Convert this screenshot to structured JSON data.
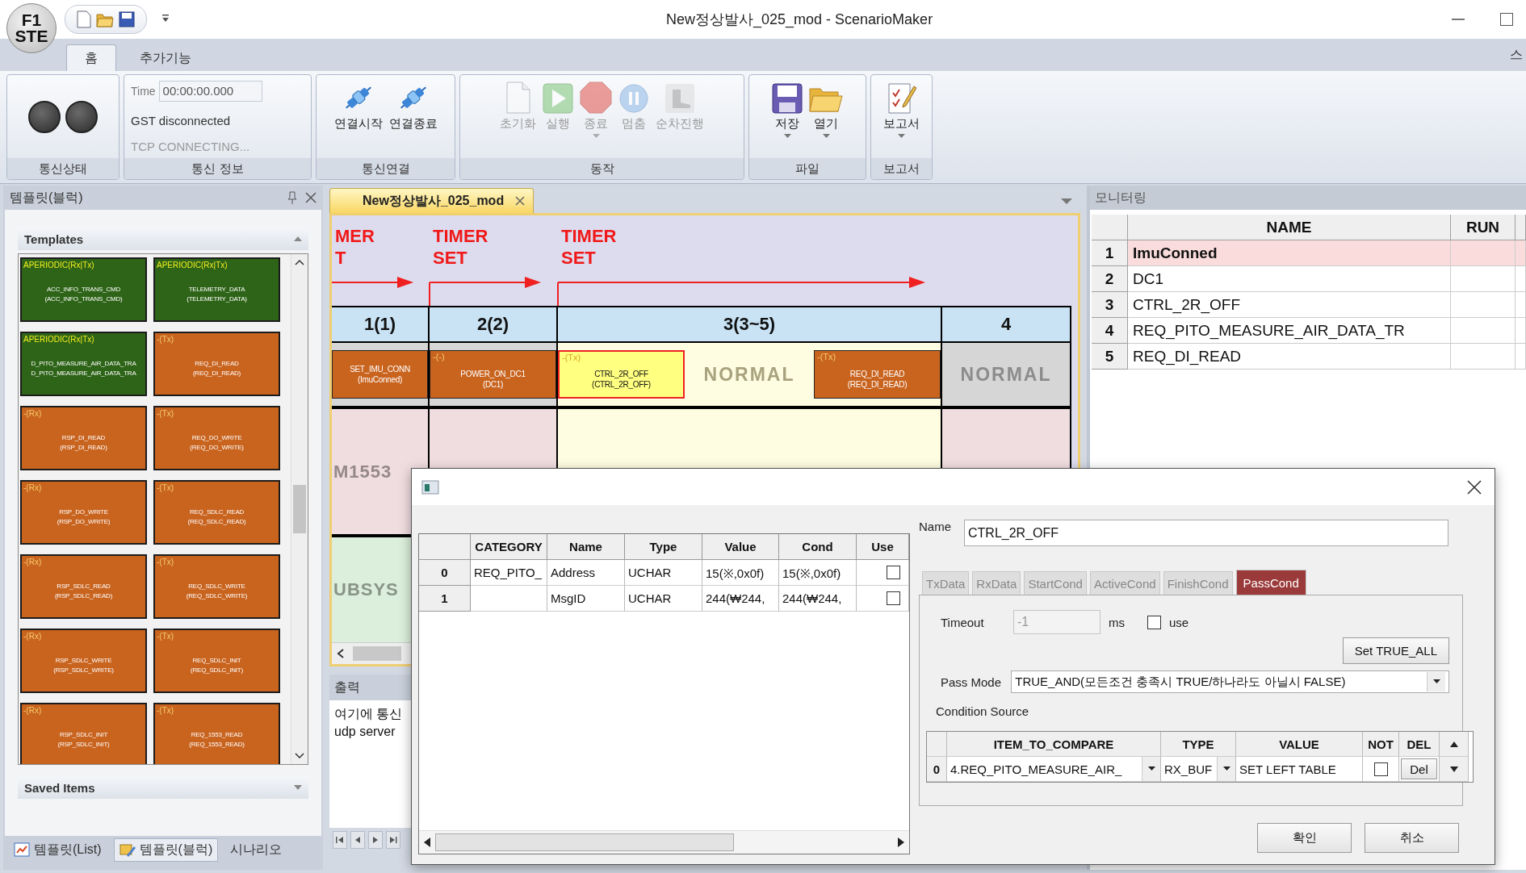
{
  "window": {
    "title": "New정상발사_025_mod - ScenarioMaker",
    "logo_lines": [
      "F1",
      "STE"
    ]
  },
  "ribbon": {
    "tabs": [
      {
        "label": "홈",
        "selected": true
      },
      {
        "label": "추가기능",
        "selected": false
      }
    ],
    "right_tab": "스",
    "groups": [
      {
        "label": "통신상태",
        "kind": "lamps",
        "lamps": [
          {
            "on": false
          },
          {
            "on": false
          }
        ]
      },
      {
        "label": "통신 정보",
        "kind": "info",
        "time_label": "Time",
        "time_value": "00:00:00.000",
        "lines": [
          {
            "text": "GST disconnected",
            "disabled": false
          },
          {
            "text": "TCP CONNECTING...",
            "disabled": true
          }
        ]
      },
      {
        "label": "통신연결",
        "kind": "buttons",
        "buttons": [
          {
            "label": "연결시작",
            "disabled": false,
            "menu": false
          },
          {
            "label": "연결종료",
            "disabled": false,
            "menu": false
          }
        ]
      },
      {
        "label": "동작",
        "kind": "buttons",
        "buttons": [
          {
            "label": "초기화",
            "disabled": true,
            "menu": false
          },
          {
            "label": "실행",
            "disabled": true,
            "menu": false
          },
          {
            "label": "종료",
            "disabled": true,
            "menu": true
          },
          {
            "label": "멈춤",
            "disabled": true,
            "menu": false
          },
          {
            "label": "순차진행",
            "disabled": true,
            "menu": false
          }
        ]
      },
      {
        "label": "파일",
        "kind": "buttons",
        "buttons": [
          {
            "label": "저장",
            "disabled": false,
            "menu": true
          },
          {
            "label": "열기",
            "disabled": false,
            "menu": true
          }
        ]
      },
      {
        "label": "보고서",
        "kind": "buttons",
        "buttons": [
          {
            "label": "보고서",
            "disabled": false,
            "menu": true
          }
        ]
      }
    ]
  },
  "templates": {
    "title": "템플릿(블럭)",
    "templates_label": "Templates",
    "saved_label": "Saved Items",
    "items": [
      {
        "kind": "aperiodic",
        "tag": "APERIODIC(Rx|Tx)",
        "lines": [
          "ACC_INFO_TRANS_CMD",
          "(ACC_INFO_TRANS_CMD)"
        ]
      },
      {
        "kind": "aperiodic",
        "tag": "APERIODIC(Rx|Tx)",
        "lines": [
          "TELEMETRY_DATA",
          "(TELEMETRY_DATA)"
        ]
      },
      {
        "kind": "aperiodic",
        "tag": "APERIODIC(Rx|Tx)",
        "lines": [
          "D_PITO_MEASURE_AIR_DATA_TRA",
          "D_PITO_MEASURE_AIR_DATA_TRA"
        ]
      },
      {
        "kind": "normal",
        "tag": "-(Tx)",
        "lines": [
          "REQ_DI_READ",
          "(REQ_DI_READ)"
        ]
      },
      {
        "kind": "normal",
        "tag": "-(Rx)",
        "lines": [
          "RSP_DI_READ",
          "(RSP_DI_READ)"
        ]
      },
      {
        "kind": "normal",
        "tag": "-(Tx)",
        "lines": [
          "REQ_DO_WRITE",
          "(REQ_DO_WRITE)"
        ]
      },
      {
        "kind": "normal",
        "tag": "-(Rx)",
        "lines": [
          "RSP_DO_WRITE",
          "(RSP_DO_WRITE)"
        ]
      },
      {
        "kind": "normal",
        "tag": "-(Tx)",
        "lines": [
          "REQ_SDLC_READ",
          "(REQ_SDLC_READ)"
        ]
      },
      {
        "kind": "normal",
        "tag": "-(Rx)",
        "lines": [
          "RSP_SDLC_READ",
          "(RSP_SDLC_READ)"
        ]
      },
      {
        "kind": "normal",
        "tag": "-(Tx)",
        "lines": [
          "REQ_SDLC_WRITE",
          "(REQ_SDLC_WRITE)"
        ]
      },
      {
        "kind": "normal",
        "tag": "-(Rx)",
        "lines": [
          "RSP_SDLC_WRITE",
          "(RSP_SDLC_WRITE)"
        ]
      },
      {
        "kind": "normal",
        "tag": "-(Tx)",
        "lines": [
          "REQ_SDLC_INIT",
          "(REQ_SDLC_INIT)"
        ]
      },
      {
        "kind": "normal",
        "tag": "-(Rx)",
        "lines": [
          "RSP_SDLC_INIT",
          "(RSP_SDLC_INIT)"
        ]
      },
      {
        "kind": "normal",
        "tag": "-(Tx)",
        "lines": [
          "REQ_1553_READ",
          "(REQ_1553_READ)"
        ]
      }
    ],
    "bottom_tabs": [
      {
        "label": "템플릿(List)",
        "selected": false
      },
      {
        "label": "템플릿(블럭)",
        "selected": true
      },
      {
        "label": "시나리오",
        "selected": false
      }
    ]
  },
  "editor": {
    "tab": {
      "label": "New정상발사_025_mod",
      "selected": true
    },
    "columns": [
      {
        "header": "1(1)",
        "active": false,
        "timer": {
          "lines": [
            "MER",
            "T"
          ],
          "partial": true
        },
        "blocks": [
          {
            "kind": "block",
            "lines": [
              "SET_IMU_CONN",
              "(ImuConned)"
            ],
            "selected": false
          }
        ]
      },
      {
        "header": "2(2)",
        "active": false,
        "timer": {
          "lines": [
            "TIMER",
            "SET"
          ],
          "partial": false
        },
        "blocks": [
          {
            "kind": "block",
            "tag": "-(-)",
            "lines": [
              "POWER_ON_DC1",
              "(DC1)"
            ],
            "selected": false
          }
        ]
      },
      {
        "header": "3(3~5)",
        "active": true,
        "timer": {
          "lines": [
            "TIMER",
            "SET"
          ],
          "partial": false
        },
        "blocks": [
          {
            "kind": "block",
            "tag": "-(Tx)",
            "lines": [
              "CTRL_2R_OFF",
              "(CTRL_2R_OFF)"
            ],
            "selected": true
          },
          {
            "kind": "state",
            "label": "NORMAL"
          },
          {
            "kind": "block",
            "tag": "-(Tx)",
            "lines": [
              "REQ_DI_READ",
              "(REQ_DI_READ)"
            ],
            "selected": false
          }
        ]
      },
      {
        "header": "4",
        "active": false,
        "blocks": [
          {
            "kind": "state",
            "label": "NORMAL"
          }
        ]
      }
    ],
    "lanes": [
      {
        "label": "M1553",
        "color": "#f0dde0"
      },
      {
        "label": "UBSYS",
        "color": "#dcefdc"
      }
    ],
    "output": {
      "title": "출력",
      "lines": [
        "여기에 통신",
        "udp server"
      ]
    }
  },
  "monitor": {
    "title": "모니터링",
    "columns": [
      "NAME",
      "RUN"
    ],
    "rows": [
      {
        "index": "1",
        "name": "ImuConned",
        "selected": true
      },
      {
        "index": "2",
        "name": "DC1",
        "selected": false
      },
      {
        "index": "3",
        "name": "CTRL_2R_OFF",
        "selected": false
      },
      {
        "index": "4",
        "name": "REQ_PITO_MEASURE_AIR_DATA_TR",
        "selected": false
      },
      {
        "index": "5",
        "name": "REQ_DI_READ",
        "selected": false
      }
    ]
  },
  "dialog": {
    "table": {
      "columns": [
        "CATEGORY",
        "Name",
        "Type",
        "Value",
        "Cond",
        "Use"
      ],
      "rows": [
        {
          "index": "0",
          "category": "REQ_PITO_",
          "name": "Address",
          "type": "UCHAR",
          "value": "15(※,0x0f)",
          "cond": "15(※,0x0f)",
          "use": false
        },
        {
          "index": "1",
          "name": "MsgID",
          "type": "UCHAR",
          "value": "244(₩244,",
          "cond": "244(₩244,",
          "use": false
        }
      ]
    },
    "name_label": "Name",
    "name_value": "CTRL_2R_OFF",
    "tabs": [
      {
        "label": "TxData",
        "selected": false
      },
      {
        "label": "RxData",
        "selected": false
      },
      {
        "label": "StartCond",
        "selected": false
      },
      {
        "label": "ActiveCond",
        "selected": false
      },
      {
        "label": "FinishCond",
        "selected": false
      },
      {
        "label": "PassCond",
        "selected": true
      }
    ],
    "timeout_label": "Timeout",
    "timeout_value": "-1",
    "timeout_unit": "ms",
    "use_label": "use",
    "use_checked": false,
    "set_all_button": "Set TRUE_ALL",
    "pass_mode_label": "Pass Mode",
    "pass_mode_value": "TRUE_AND(모든조건 충족시 TRUE/하나라도 아닐시 FALSE)",
    "condition_source_label": "Condition Source",
    "conditions": {
      "columns": [
        "ITEM_TO_COMPARE",
        "TYPE",
        "VALUE",
        "NOT",
        "DEL"
      ],
      "rows": [
        {
          "index": "0",
          "item": "4.REQ_PITO_MEASURE_AIR_",
          "type": "RX_BUF",
          "value": "SET LEFT TABLE",
          "not": false,
          "del": "Del"
        }
      ]
    },
    "buttons": [
      "확인",
      "취소"
    ]
  }
}
